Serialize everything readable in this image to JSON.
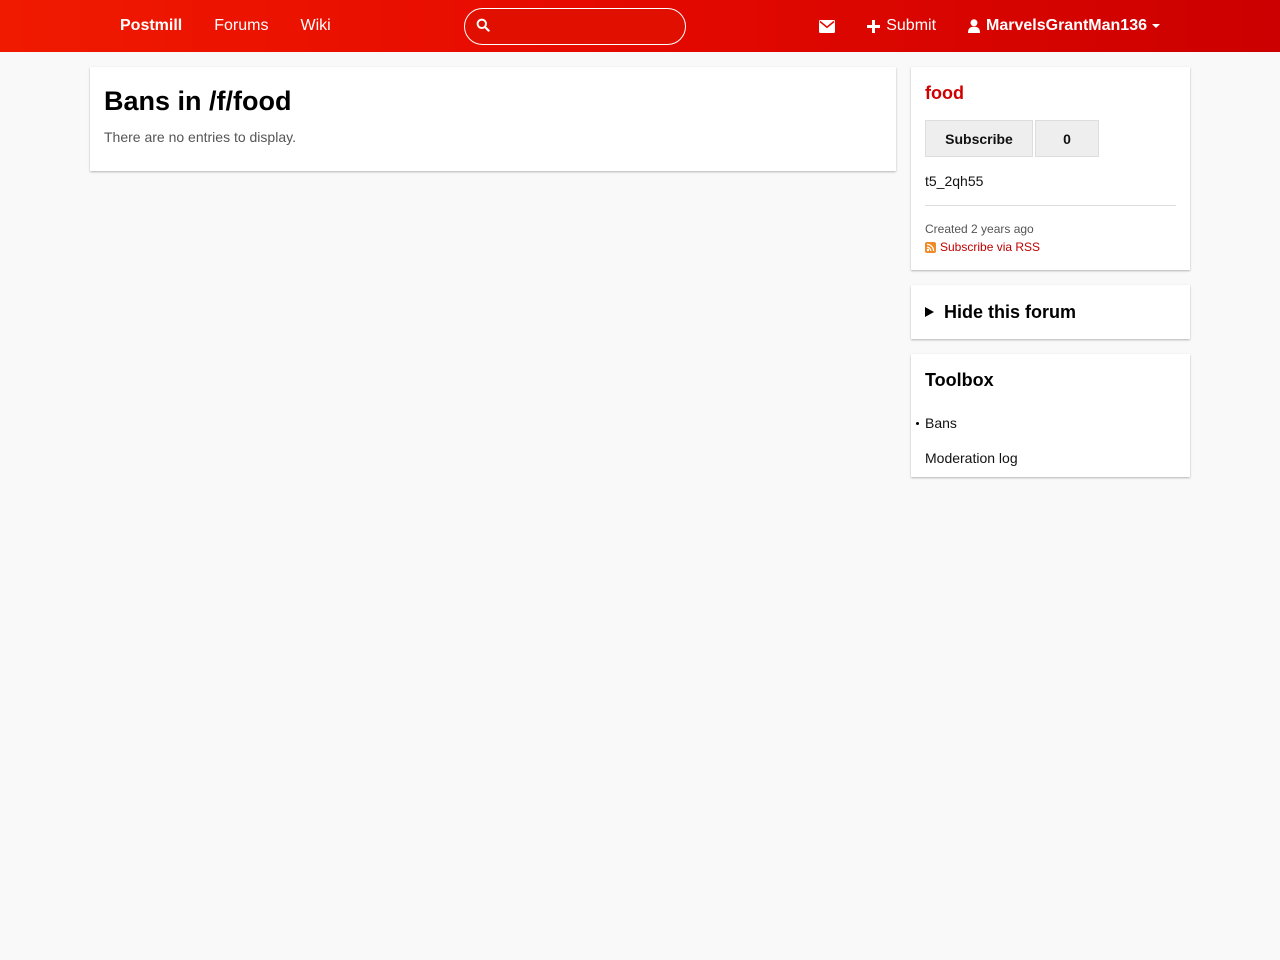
{
  "header": {
    "brand": "Postmill",
    "nav": [
      {
        "label": "Forums"
      },
      {
        "label": "Wiki"
      }
    ],
    "search": {
      "value": "",
      "placeholder": ""
    },
    "submit_label": "Submit",
    "user_name": "MarvelsGrantMan136",
    "icons": {
      "search": "search-icon",
      "messages": "envelope-icon",
      "submit": "plus-icon",
      "user": "user-icon",
      "menu": "caret-down-icon"
    },
    "colors": {
      "bar_start": "#f01a00",
      "bar_end": "#cc0000"
    }
  },
  "main": {
    "title": "Bans in /f/food",
    "empty_message": "There are no entries to display."
  },
  "sidebar": {
    "forum": {
      "name": "food",
      "subscribe_label": "Subscribe",
      "subscriber_count": "0",
      "description": "t5_2qh55",
      "created": "Created 2 years ago",
      "rss_label": "Subscribe via RSS"
    },
    "hide": {
      "label": "Hide this forum"
    },
    "toolbox": {
      "title": "Toolbox",
      "items": [
        {
          "label": "Bans",
          "current": true
        },
        {
          "label": "Moderation log",
          "current": false
        }
      ]
    },
    "colors": {
      "link": "#d00000",
      "rss": "#f08a24"
    }
  }
}
